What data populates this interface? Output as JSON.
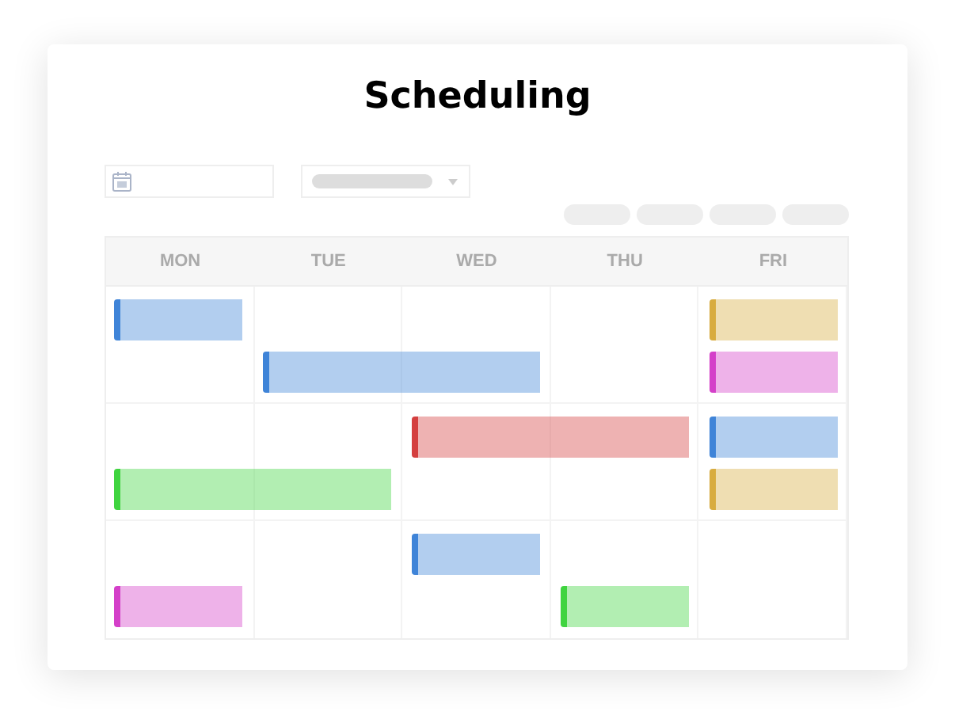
{
  "title": "Scheduling",
  "days": [
    "MON",
    "TUE",
    "WED",
    "THU",
    "FRI"
  ],
  "weeks": [
    {
      "lanes": [
        [
          {
            "color": "#3f84d8",
            "days": [
              true,
              false,
              false,
              false,
              false
            ]
          },
          {
            "color": "#d8ac3f",
            "days": [
              false,
              false,
              false,
              false,
              true
            ]
          }
        ],
        [
          {
            "color": "#3f84d8",
            "days": [
              false,
              true,
              true,
              false,
              false
            ]
          },
          {
            "color": "#d43fc9",
            "days": [
              false,
              false,
              false,
              false,
              true
            ]
          }
        ]
      ]
    },
    {
      "lanes": [
        [
          {
            "color": "#d43f3f",
            "days": [
              false,
              false,
              true,
              true,
              false
            ]
          },
          {
            "color": "#3f84d8",
            "days": [
              false,
              false,
              false,
              false,
              true
            ]
          }
        ],
        [
          {
            "color": "#3fd43f",
            "days": [
              true,
              true,
              false,
              false,
              false
            ]
          },
          {
            "color": "#d8ac3f",
            "days": [
              false,
              false,
              false,
              false,
              true
            ]
          }
        ]
      ]
    },
    {
      "lanes": [
        [
          {
            "color": "#3f84d8",
            "days": [
              false,
              false,
              true,
              false,
              false
            ]
          }
        ],
        [
          {
            "color": "#d43fc9",
            "days": [
              true,
              false,
              false,
              false,
              false
            ]
          },
          {
            "color": "#3fd43f",
            "days": [
              false,
              false,
              false,
              true,
              false
            ]
          }
        ]
      ]
    }
  ]
}
